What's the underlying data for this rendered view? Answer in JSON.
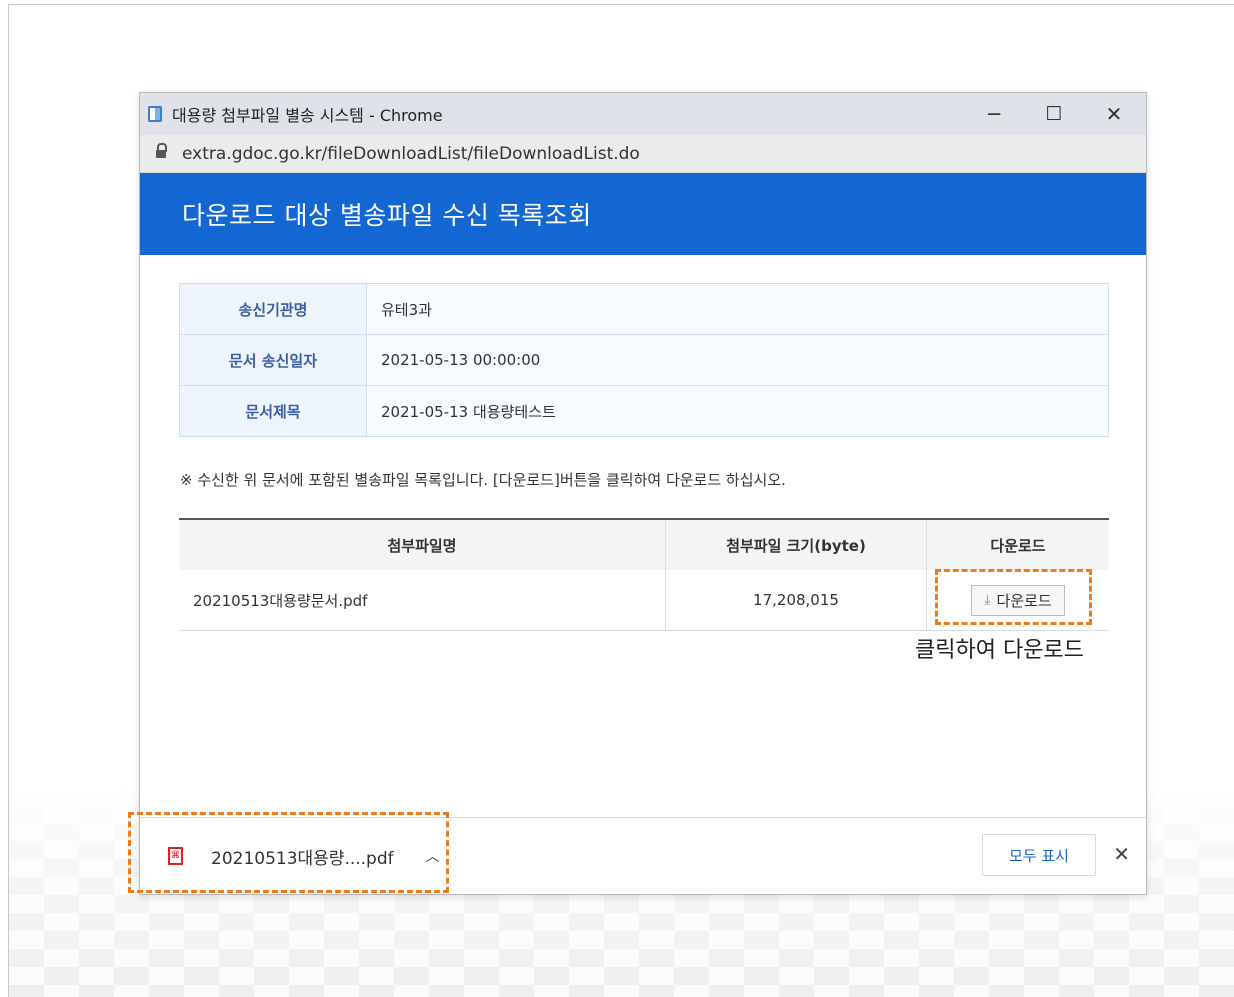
{
  "window": {
    "title": "대용량 첨부파일 별송 시스템 - Chrome",
    "controls": {
      "minimize": "─",
      "maximize": "☐",
      "close": "✕"
    },
    "url": "extra.gdoc.go.kr/fileDownloadList/fileDownloadList.do"
  },
  "banner": {
    "title": "다운로드 대상 별송파일 수신 목록조회"
  },
  "info": {
    "rows": [
      {
        "label": "송신기관명",
        "value": "유테3과"
      },
      {
        "label": "문서 송신일자",
        "value": "2021-05-13 00:00:00"
      },
      {
        "label": "문서제목",
        "value": "2021-05-13 대용량테스트"
      }
    ]
  },
  "note": "※ 수신한 위 문서에 포함된 별송파일 목록입니다. [다운로드]버튼을 클릭하여 다운로드 하십시오.",
  "files": {
    "headers": [
      "첨부파일명",
      "첨부파일 크기(byte)",
      "다운로드"
    ],
    "rows": [
      {
        "name": "20210513대용량문서.pdf",
        "size": "17,208,015",
        "button": "다운로드"
      }
    ]
  },
  "hint": "클릭하여 다운로드",
  "downloadBar": {
    "filename": "20210513대용량....pdf",
    "show_all": "모두 표시",
    "close": "✕"
  },
  "colors": {
    "accent": "#1467d3",
    "highlight": "#ee7b1a"
  }
}
